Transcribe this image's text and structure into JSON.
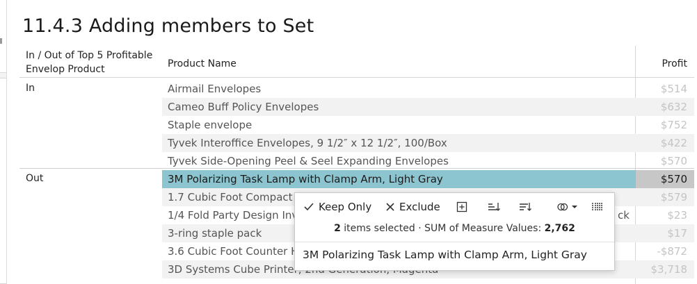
{
  "sheet": {
    "title": "11.4.3 Adding members to Set"
  },
  "headers": {
    "dimension": "In / Out of Top 5 Profitable Envelop Product",
    "product_name": "Product Name",
    "profit": "Profit"
  },
  "groups": {
    "in": "In",
    "out": "Out"
  },
  "rows": [
    {
      "name": "Airmail Envelopes",
      "profit": "$514"
    },
    {
      "name": "Cameo Buff Policy Envelopes",
      "profit": "$632"
    },
    {
      "name": "Staple envelope",
      "profit": "$752"
    },
    {
      "name": "Tyvek Interoffice Envelopes, 9 1/2″ x 12 1/2″, 100/Box",
      "profit": "$422"
    },
    {
      "name": "Tyvek Side-Opening Peel & Seel Expanding Envelopes",
      "profit": "$570"
    },
    {
      "name": "3M Polarizing Task Lamp with Clamp Arm, Light Gray",
      "profit": "$570"
    },
    {
      "name": "1.7 Cubic Foot Compact “",
      "profit": "$579"
    },
    {
      "name": "1/4 Fold Party Design Inv",
      "profit": "$23"
    },
    {
      "name": "3-ring staple pack",
      "profit": "$17"
    },
    {
      "name": "3.6 Cubic Foot Counter H",
      "profit": "-$872"
    },
    {
      "name": "3D Systems Cube Printer, 2nd Generation, Magenta",
      "profit": "$3,718"
    }
  ],
  "peek_text": "ck",
  "tooltip": {
    "keep_only": "Keep Only",
    "exclude": "Exclude",
    "summary_count": "2",
    "summary_text": "items selected",
    "summary_dot": "·",
    "summary_measure": "SUM of Measure Values:",
    "summary_value": "2,762",
    "item": "3M Polarizing Task Lamp with Clamp Arm, Light Gray"
  },
  "icons": {
    "keep_only": "check-icon",
    "exclude": "x-icon",
    "create_set": "add-set-icon",
    "sort_asc": "sort-ascending-icon",
    "sort_desc": "sort-descending-icon",
    "group": "group-members-icon",
    "view_data": "view-data-icon"
  },
  "colors": {
    "selection": "#8cc5cf",
    "selection_value_bg": "#c7c7c7",
    "band": "#f2f2f2",
    "dim_value": "#c4c4c4"
  }
}
